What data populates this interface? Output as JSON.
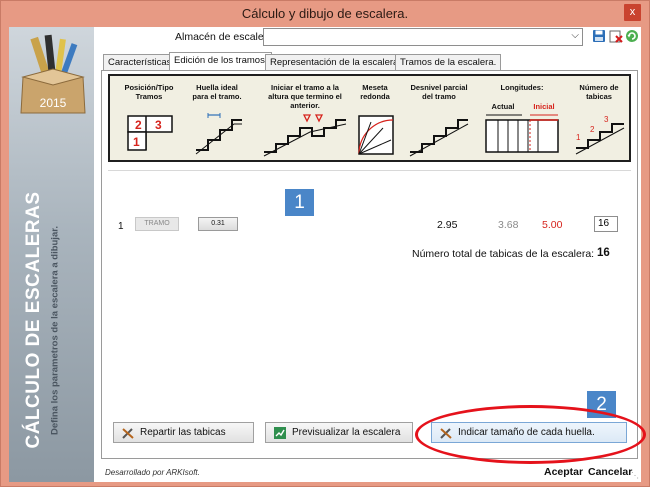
{
  "window": {
    "title": "Cálculo y dibujo de escalera.",
    "close_label": "x"
  },
  "brand": {
    "year": "2015",
    "vertical_title": "CÁLCULO DE ESCALERAS",
    "vertical_subtitle": "Defina los parametros de la escalera a dibujar."
  },
  "toolbar": {
    "store_label": "Almacén de escaleras",
    "store_value": "",
    "save_icon": "save-icon",
    "delete_icon": "delete-icon",
    "refresh_icon": "refresh-icon"
  },
  "tabs": [
    {
      "label": "Características."
    },
    {
      "label": "Edición de los tramos."
    },
    {
      "label": "Representación de la escalera."
    },
    {
      "label": "Tramos de la escalera."
    }
  ],
  "header": {
    "col_position": "Posición/Tipo Tramos",
    "col_position_digits": [
      "2",
      "3",
      "1"
    ],
    "col_huella": "Huella ideal para el tramo.",
    "col_iniciar": "Iniciar el tramo a la altura que termino el anterior.",
    "col_meseta": "Meseta redonda",
    "col_desnivel": "Desnivel parcial del tramo",
    "col_longitudes": "Longitudes:",
    "col_actual": "Actual",
    "col_inicial": "Inicial",
    "col_tabicas": "Número de tabicas",
    "col_tabicas_digits": [
      "1",
      "2",
      "3"
    ]
  },
  "row": {
    "number": "1",
    "tramo_label": "TRAMO",
    "huella_label": "0.31",
    "desnivel": "2.95",
    "actual": "3.68",
    "inicial": "5.00",
    "tabicas": "16"
  },
  "summary": {
    "label": "Número total de tabicas de la escalera:",
    "value": "16"
  },
  "badges": {
    "one": "1",
    "two": "2"
  },
  "buttons": {
    "repartir": "Repartir las tabicas",
    "previsualizar": "Previsualizar la escalera",
    "indicar": "Indicar tamaño de cada huella."
  },
  "footer": {
    "developer": "Desarrollado por ARKIsoft.",
    "accept": "Aceptar",
    "cancel": "Cancelar"
  },
  "colors": {
    "accent_blue": "#4a86c8",
    "highlight_red": "#e5121b",
    "titlebar": "#e79a84"
  }
}
